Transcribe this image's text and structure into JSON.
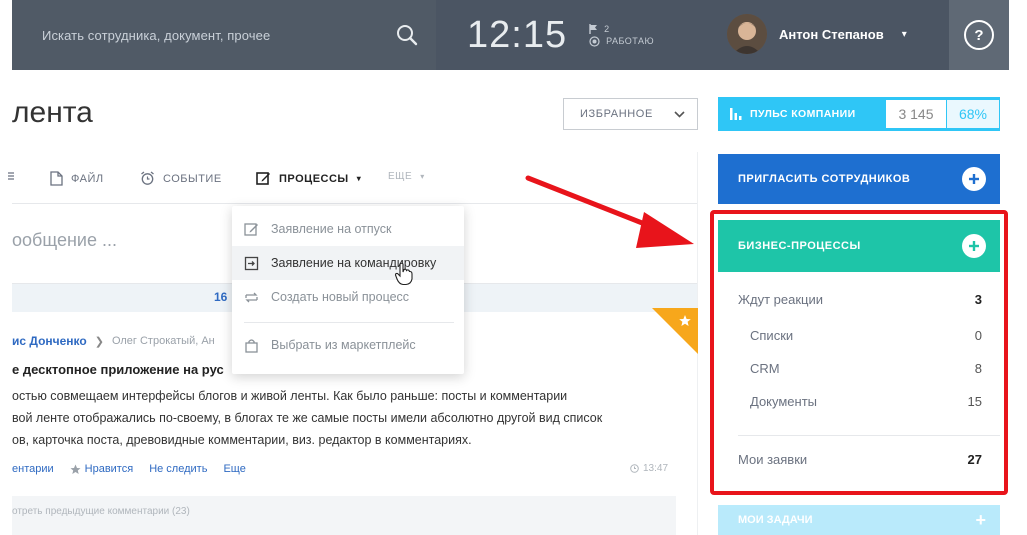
{
  "topbar": {
    "search_placeholder": "Искать сотрудника, документ, прочее",
    "clock": "12:15",
    "flag_count": "2",
    "work_status": "РАБОТАЮ",
    "user_name": "Антон Степанов",
    "user_caret": "▾",
    "help": "?"
  },
  "page": {
    "title": "лента",
    "favorites_label": "ИЗБРАННОЕ"
  },
  "toolbar": {
    "items": [
      {
        "label": "ФАЙЛ"
      },
      {
        "label": "СОБЫТИЕ"
      },
      {
        "label": "ПРОЦЕССЫ"
      },
      {
        "label": "ЕЩЕ"
      }
    ]
  },
  "composer": {
    "placeholder": "ообщение ..."
  },
  "pager": {
    "count": "16"
  },
  "dropdown": {
    "items": [
      {
        "label": "Заявление на отпуск"
      },
      {
        "label": "Заявление на командировку"
      },
      {
        "label": "Создать новый процесс"
      },
      {
        "label": "Выбрать из маркетплейс"
      }
    ]
  },
  "post": {
    "author": "ис Донченко",
    "recipients": "Олег Строкатый, Ан",
    "title": "е десктопное приложение на рус",
    "body": [
      "остью совмещаем интерфейсы блогов и живой ленты. Как было раньше: посты и комментарии",
      "вой ленте отображались по-своему, в блогах те же самые посты имели абсолютно другой вид список",
      "ов, карточка поста, древовидные комментарии, виз. редактор в комментариях."
    ],
    "actions": {
      "comments": "ентарии",
      "like": "Нравится",
      "unfollow": "Не следить",
      "more": "Еще"
    },
    "time": "13:47",
    "prev_comments": "отреть предыдущие комментарии (23)"
  },
  "sidebar": {
    "pulse_label": "ПУЛЬС КОМПАНИИ",
    "pulse_count": "3 145",
    "pulse_percent": "68%",
    "invite_label": "ПРИГЛАСИТЬ СОТРУДНИКОВ",
    "bp_title": "БИЗНЕС-ПРОЦЕССЫ",
    "bp_rows": [
      {
        "label": "Ждут реакции",
        "value": "3"
      },
      {
        "label": "Списки",
        "value": "0"
      },
      {
        "label": "CRM",
        "value": "8"
      },
      {
        "label": "Документы",
        "value": "15"
      },
      {
        "label": "Мои заявки",
        "value": "27"
      }
    ],
    "mytasks_label": "МОИ ЗАДАЧИ"
  },
  "colors": {
    "topbar": "#4b5563",
    "pulse": "#2fc6f6",
    "invite": "#1e6fd0",
    "bp_header": "#1ec5a8",
    "highlight_frame": "#e8141b",
    "arrow": "#e8141b",
    "link": "#2f6ac2"
  }
}
